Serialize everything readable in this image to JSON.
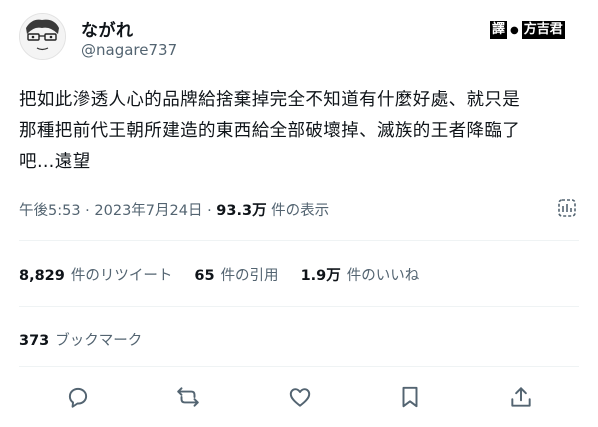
{
  "user": {
    "display_name": "ながれ",
    "handle": "@nagare737"
  },
  "watermark": {
    "left": "譯",
    "dot": "●",
    "right": "方吉君"
  },
  "tweet": {
    "text": "把如此滲透人心的品牌給捨棄掉完全不知道有什麼好處、就只是\n那種把前代王朝所建造的東西給全部破壞掉、滅族的王者降臨了\n吧…遠望"
  },
  "meta": {
    "time": "午後5:53",
    "sep1": " · ",
    "date": "2023年7月24日",
    "sep2": " · ",
    "views_count": "93.3万",
    "views_label": " 件の表示"
  },
  "stats": {
    "retweets_count": "8,829",
    "retweets_label": "件のリツイート",
    "quotes_count": "65",
    "quotes_label": "件の引用",
    "likes_count": "1.9万",
    "likes_label": "件のいいね",
    "bookmarks_count": "373",
    "bookmarks_label": "ブックマーク"
  },
  "icons": [
    "reply-icon",
    "retweet-icon",
    "like-icon",
    "bookmark-icon",
    "share-icon",
    "analytics-icon"
  ],
  "colors": {
    "text": "#0f1419",
    "secondary": "#536471",
    "divider": "#eff3f4"
  }
}
